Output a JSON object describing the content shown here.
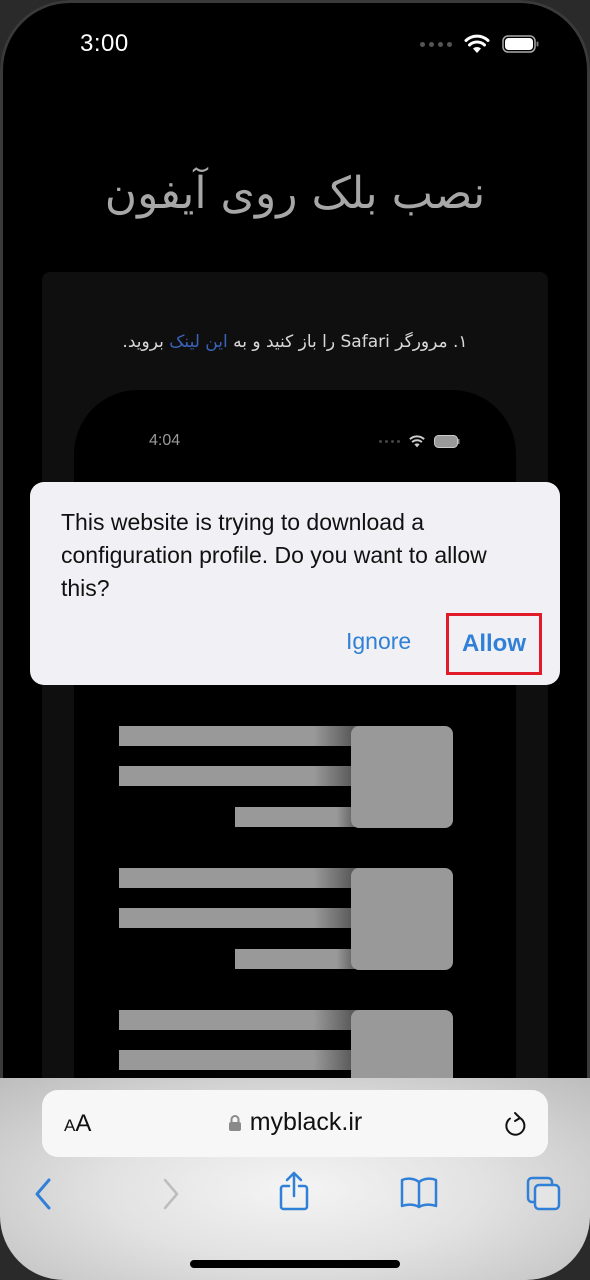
{
  "status_bar": {
    "time": "3:00"
  },
  "page": {
    "title": "نصب بلک روی آیفون",
    "step": {
      "prefix": "۱. مرورگر Safari را باز کنید و به ",
      "link": "این لینک",
      "suffix": " بروید."
    }
  },
  "mock_phone": {
    "time": "4:04"
  },
  "alert": {
    "message": "This website is trying to download a configuration profile. Do you want to allow this?",
    "ignore_label": "Ignore",
    "allow_label": "Allow",
    "highlight_color": "#e21b2a"
  },
  "safari": {
    "text_size_small": "A",
    "text_size_big": "A",
    "url": "myblack.ir",
    "icons": [
      "text-size-icon",
      "lock-icon",
      "reload-icon",
      "back-icon",
      "forward-icon",
      "share-icon",
      "bookmarks-icon",
      "tabs-icon"
    ]
  },
  "colors": {
    "accent": "#2f80d6",
    "link": "#3a63b8"
  }
}
